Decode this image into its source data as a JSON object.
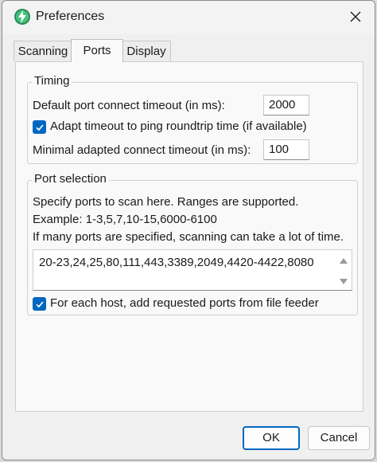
{
  "window": {
    "title": "Preferences"
  },
  "tabs": [
    {
      "label": "Scanning",
      "active": false
    },
    {
      "label": "Ports",
      "active": true
    },
    {
      "label": "Display",
      "active": false
    }
  ],
  "timing": {
    "group_title": "Timing",
    "default_timeout_label": "Default port connect timeout (in ms):",
    "default_timeout_value": "2000",
    "adapt_timeout_label": "Adapt timeout to ping roundtrip time (if available)",
    "adapt_timeout_checked": true,
    "min_adapted_label": "Minimal adapted connect timeout (in ms):",
    "min_adapted_value": "100"
  },
  "port_selection": {
    "group_title": "Port selection",
    "help_line1": "Specify ports to scan here. Ranges are supported.",
    "help_line2": "Example: 1-3,5,7,10-15,6000-6100",
    "help_line3": "If many ports are specified, scanning can take a lot of time.",
    "ports_value": "20-23,24,25,80,111,443,3389,2049,4420-4422,8080",
    "file_feeder_label": "For each host, add requested ports from file feeder",
    "file_feeder_checked": true
  },
  "buttons": {
    "ok_label": "OK",
    "cancel_label": "Cancel"
  },
  "colors": {
    "accent": "#0067c0",
    "icon_green": "#3cb371"
  }
}
